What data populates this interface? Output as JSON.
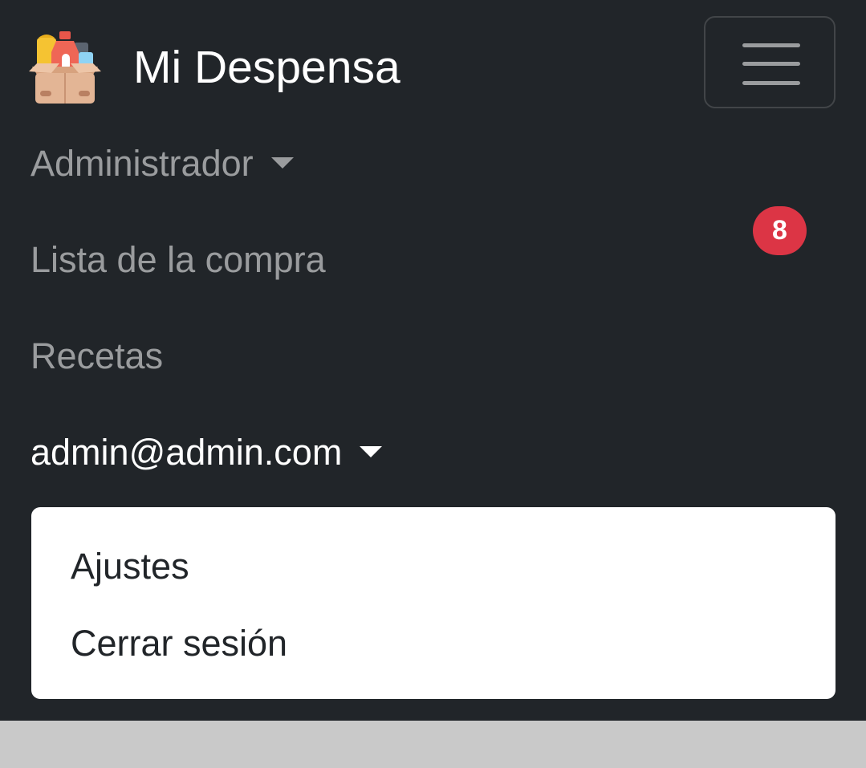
{
  "brand": {
    "name": "Mi Despensa",
    "logo_icon": "pantry-box-icon"
  },
  "toggler": {
    "icon": "hamburger-menu-icon"
  },
  "nav": {
    "admin_label": "Administrador",
    "shopping_list_label": "Lista de la compra",
    "shopping_list_badge": "8",
    "recipes_label": "Recetas",
    "user_label": "admin@admin.com"
  },
  "user_menu": {
    "settings_label": "Ajustes",
    "logout_label": "Cerrar sesión"
  },
  "colors": {
    "navbar_bg": "#212529",
    "badge_bg": "#dc3545",
    "page_bg": "#c9c9c9"
  }
}
